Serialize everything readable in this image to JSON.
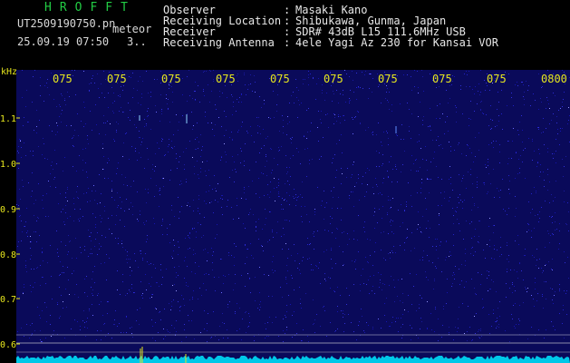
{
  "header": {
    "brand": "HROFFT",
    "filename": "UT2509190750.pn",
    "type_label": "meteor",
    "datetime": "25.09.19 07:50",
    "count": "3..",
    "info": [
      {
        "key": "Observer",
        "value": "Masaki Kano"
      },
      {
        "key": "Receiving Location",
        "value": "Shibukawa, Gunma, Japan"
      },
      {
        "key": "Receiver",
        "value": "SDR# 43dB L15 111.6MHz USB"
      },
      {
        "key": "Receiving Antenna",
        "value": "4ele Yagi Az 230 for Kansai VOR"
      }
    ]
  },
  "axes": {
    "y_unit": "kHz",
    "y_ticks": [
      "1.1",
      "1.0",
      "0.9",
      "0.8",
      "0.7",
      "0.6"
    ],
    "x_ticks": [
      "075",
      "075",
      "075",
      "075",
      "075",
      "075",
      "075",
      "075",
      "075",
      "0800"
    ]
  },
  "colors": {
    "background": "#000000",
    "spectrogram": "#0a0a5a",
    "label": "#e6e61e",
    "brand": "#22cc44",
    "trace": "#00e5ff"
  }
}
